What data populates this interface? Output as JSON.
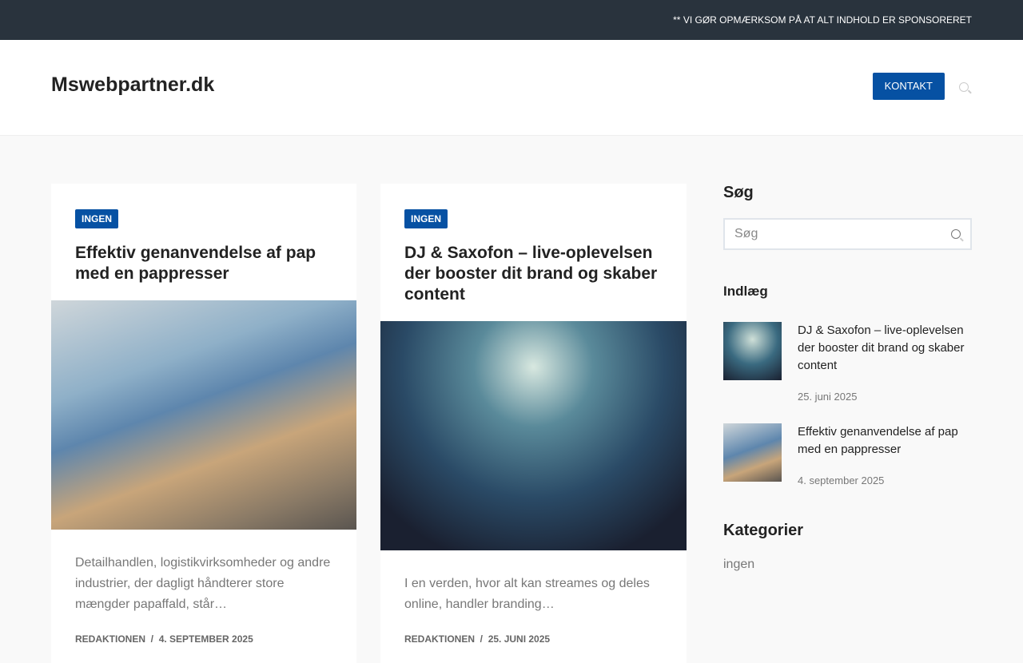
{
  "topbar": {
    "notice": "** VI GØR OPMÆRKSOM PÅ AT ALT INDHOLD ER SPONSORERET"
  },
  "header": {
    "site_title": "Mswebpartner.dk",
    "contact_label": "KONTAKT"
  },
  "posts": [
    {
      "category": "INGEN",
      "title": "Effektiv genanvendelse af pap med en pappresser",
      "excerpt": "Detailhandlen, logistikvirksomheder og andre industrier, der dagligt håndterer store mængder papaffald, står…",
      "author": "REDAKTIONEN",
      "date": "4. SEPTEMBER 2025"
    },
    {
      "category": "INGEN",
      "title": "DJ & Saxofon – live-oplevelsen der booster dit brand og skaber content",
      "excerpt": "I en verden, hvor alt kan streames og deles online, handler branding…",
      "author": "REDAKTIONEN",
      "date": "25. JUNI 2025"
    }
  ],
  "sidebar": {
    "search_heading": "Søg",
    "search_placeholder": "Søg",
    "posts_heading": "Indlæg",
    "recent": [
      {
        "title": "DJ & Saxofon – live-oplevelsen der booster dit brand og skaber content",
        "date": "25. juni 2025"
      },
      {
        "title": "Effektiv genanvendelse af pap med en pappresser",
        "date": "4. september 2025"
      }
    ],
    "categories_heading": "Kategorier",
    "categories": [
      "ingen"
    ]
  }
}
